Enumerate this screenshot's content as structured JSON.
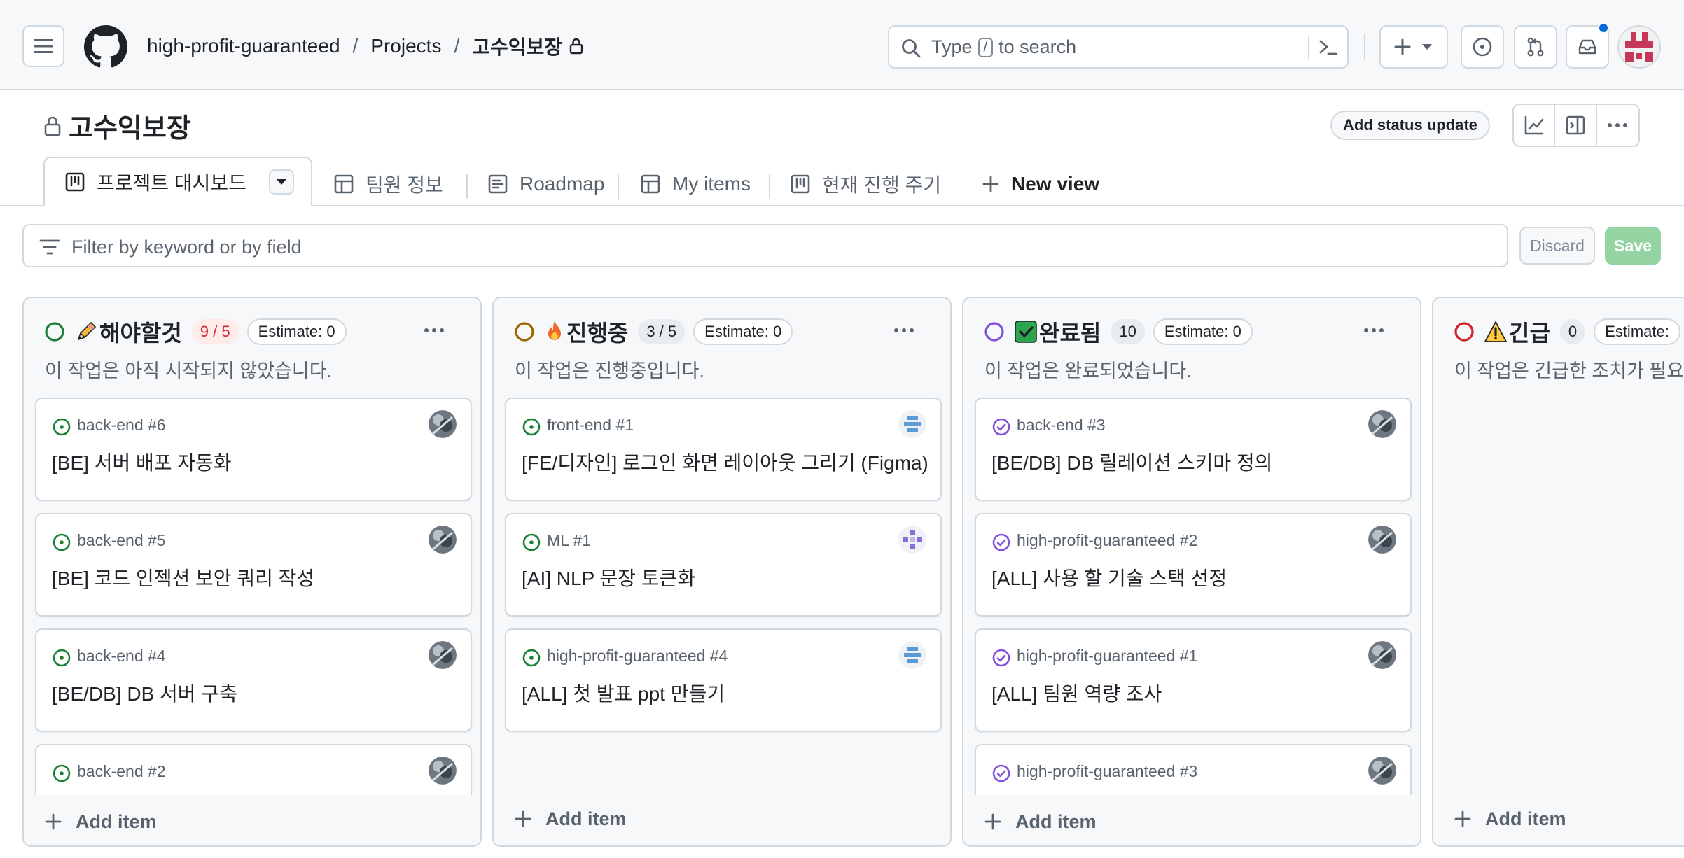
{
  "header": {
    "breadcrumb": {
      "org": "high-profit-guaranteed",
      "projects": "Projects",
      "current": "고수익보장",
      "sep": "/"
    },
    "search": {
      "prefix": "Type",
      "key": "/",
      "suffix": "to search"
    }
  },
  "project": {
    "title": "고수익보장",
    "status_update": "Add status update"
  },
  "tabs": [
    {
      "label": "프로젝트 대시보드",
      "active": true
    },
    {
      "label": "팀원 정보"
    },
    {
      "label": "Roadmap"
    },
    {
      "label": "My items"
    },
    {
      "label": "현재 진행 주기"
    },
    {
      "label": "New view"
    }
  ],
  "filter": {
    "placeholder": "Filter by keyword or by field",
    "discard": "Discard",
    "save": "Save"
  },
  "columns": [
    {
      "title": "해야할것",
      "count": "9 / 5",
      "estimate": "Estimate: 0",
      "description": "이 작업은 아직 시작되지 않았습니다.",
      "status_color": "#1a7f37",
      "cards": [
        {
          "ref": "back-end #6",
          "title": "[BE] 서버 배포 자동화"
        },
        {
          "ref": "back-end #5",
          "title": "[BE] 코드 인젝션 보안 쿼리 작성"
        },
        {
          "ref": "back-end #4",
          "title": "[BE/DB] DB 서버 구축"
        },
        {
          "ref": "back-end #2",
          "title": ""
        }
      ],
      "add_item": "Add item"
    },
    {
      "title": "진행중",
      "count": "3 / 5",
      "estimate": "Estimate: 0",
      "description": "이 작업은 진행중입니다.",
      "status_color": "#9a6700",
      "cards": [
        {
          "ref": "front-end #1",
          "title": "[FE/디자인] 로그인 화면 레이아웃 그리기 (Figma)"
        },
        {
          "ref": "ML #1",
          "title": "[AI] NLP 문장 토큰화"
        },
        {
          "ref": "high-profit-guaranteed #4",
          "title": "[ALL] 첫 발표 ppt 만들기"
        }
      ],
      "add_item": "Add item"
    },
    {
      "title": "완료됨",
      "count": "10",
      "estimate": "Estimate: 0",
      "description": "이 작업은 완료되었습니다.",
      "status_color": "#8250df",
      "cards": [
        {
          "ref": "back-end #3",
          "title": "[BE/DB] DB 릴레이션 스키마 정의"
        },
        {
          "ref": "high-profit-guaranteed #2",
          "title": "[ALL] 사용 할 기술 스택 선정"
        },
        {
          "ref": "high-profit-guaranteed #1",
          "title": "[ALL] 팀원 역량 조사"
        },
        {
          "ref": "high-profit-guaranteed #3",
          "title": ""
        }
      ],
      "add_item": "Add item"
    },
    {
      "title": "긴급",
      "count": "0",
      "estimate": "Estimate:",
      "description": "이 작업은 긴급한 조치가 필요",
      "status_color": "#cf222e",
      "cards": [],
      "add_item": "Add item"
    }
  ],
  "colors": {
    "open": "#1a7f37",
    "done": "#8250df",
    "accent": "#0969da",
    "border": "#d1d9e0"
  }
}
